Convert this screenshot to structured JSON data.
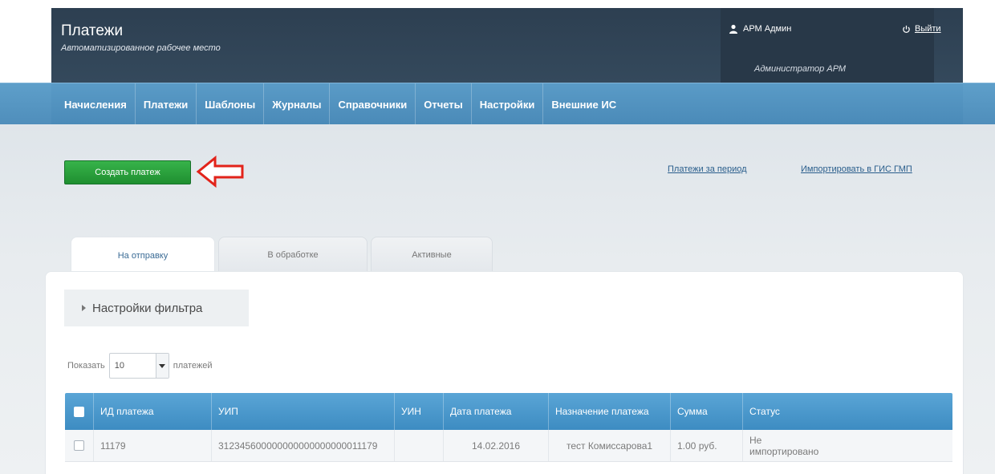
{
  "header": {
    "title": "Платежи",
    "subtitle": "Автоматизированное рабочее место",
    "user_name": "АРМ Админ",
    "user_role": "Администратор АРМ",
    "logout_label": "Выйти"
  },
  "nav": {
    "items": [
      "Начисления",
      "Платежи",
      "Шаблоны",
      "Журналы",
      "Справочники",
      "Отчеты",
      "Настройки",
      "Внешние ИС"
    ]
  },
  "toolbar": {
    "create_label": "Создать платеж",
    "link_period": "Платежи за период",
    "link_import": "Импортировать в ГИС ГМП"
  },
  "tabs": [
    "На отправку",
    "В обработке",
    "Активные"
  ],
  "filter": {
    "label": "Настройки фильтра"
  },
  "page_size": {
    "prefix": "Показать",
    "value": "10",
    "suffix": "платежей"
  },
  "table": {
    "headers": [
      "ИД платежа",
      "УИП",
      "УИН",
      "Дата платежа",
      "Назначение платежа",
      "Сумма",
      "Статус"
    ],
    "rows": [
      {
        "id": "11179",
        "uip": "312345600000000000000000011179",
        "uin": "",
        "date": "14.02.2016",
        "purpose": "тест Комиссарова1",
        "amount": "1.00 руб.",
        "status": "Не импортировано"
      }
    ]
  },
  "colors": {
    "header_bg": "#2d3f51",
    "nav_bg": "#4f8ebb",
    "create_button": "#28a53a",
    "table_header": "#4a98cc",
    "arrow": "#e2231a"
  }
}
